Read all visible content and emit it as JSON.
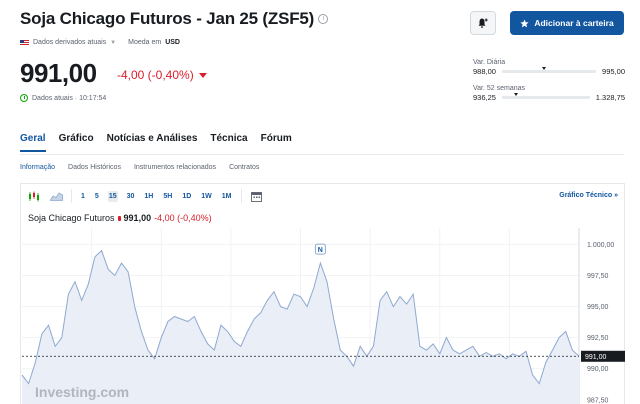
{
  "header": {
    "title": "Soja Chicago Futuros - Jan 25 (ZSF5)",
    "meta_source": "Dados derivados atuais",
    "meta_currency_label": "Moeda em",
    "meta_currency": "USD",
    "add_button_label": "Adicionar à carteira"
  },
  "quote": {
    "price": "991,00",
    "change": "-4,00 (-0,40%)",
    "time_label": "Dados atuais · 10:17:54"
  },
  "ranges": {
    "daily_label": "Var. Diária",
    "daily_low": "988,00",
    "daily_high": "995,00",
    "daily_position": 0.43,
    "week52_label": "Var. 52 semanas",
    "week52_low": "936,25",
    "week52_high": "1.328,75",
    "week52_position": 0.14
  },
  "tabs": [
    "Geral",
    "Gráfico",
    "Notícias e Análises",
    "Técnica",
    "Fórum"
  ],
  "subtabs": [
    "Informação",
    "Dados Históricos",
    "Instrumentos relacionados",
    "Contratos"
  ],
  "chart_toolbar": {
    "timeframes": [
      "1",
      "5",
      "15",
      "30",
      "1H",
      "5H",
      "1D",
      "1W",
      "1M"
    ],
    "active_timeframe": "15",
    "tech_link": "Gráfico Técnico »"
  },
  "legend": {
    "name": "Soja Chicago Futuros",
    "price": "991,00",
    "change": "-4,00 (-0,40%)"
  },
  "watermark": "Investing.com",
  "news_marker": "N",
  "colors": {
    "accent": "#1256a0",
    "negative": "#d91e2b",
    "line": "#8fa9cf",
    "fill": "#e9eef7"
  },
  "chart_data": {
    "type": "area",
    "ylim": [
      987.0,
      1001.0
    ],
    "yticks": [
      "1.000,00",
      "997,50",
      "995,00",
      "992,50",
      "990,00",
      "987,50"
    ],
    "ytick_values": [
      1000.0,
      997.5,
      995.0,
      992.5,
      990.0,
      987.5
    ],
    "last_value": 991.0,
    "last_label": "991,00",
    "values": [
      989.5,
      988.8,
      990.5,
      992.8,
      993.5,
      991.8,
      992.5,
      996.0,
      997.0,
      995.5,
      996.8,
      999.0,
      999.5,
      998.0,
      997.5,
      998.5,
      997.8,
      995.0,
      993.0,
      991.5,
      990.8,
      992.5,
      993.8,
      994.2,
      994.0,
      993.8,
      994.2,
      993.0,
      992.0,
      991.5,
      993.5,
      993.0,
      992.2,
      991.8,
      993.0,
      994.0,
      994.5,
      995.5,
      996.2,
      995.0,
      994.8,
      996.0,
      995.8,
      995.0,
      996.5,
      998.5,
      997.0,
      994.0,
      991.5,
      991.0,
      990.2,
      991.8,
      991.0,
      991.8,
      995.5,
      996.2,
      995.0,
      995.8,
      995.2,
      996.0,
      991.8,
      991.5,
      992.0,
      991.2,
      992.5,
      991.5,
      991.2,
      991.5,
      991.8,
      991.0,
      991.3,
      991.0,
      991.2,
      990.8,
      991.2,
      991.0,
      991.4,
      989.5,
      988.8,
      990.5,
      991.5,
      992.5,
      993.0,
      991.5,
      991.0
    ]
  }
}
